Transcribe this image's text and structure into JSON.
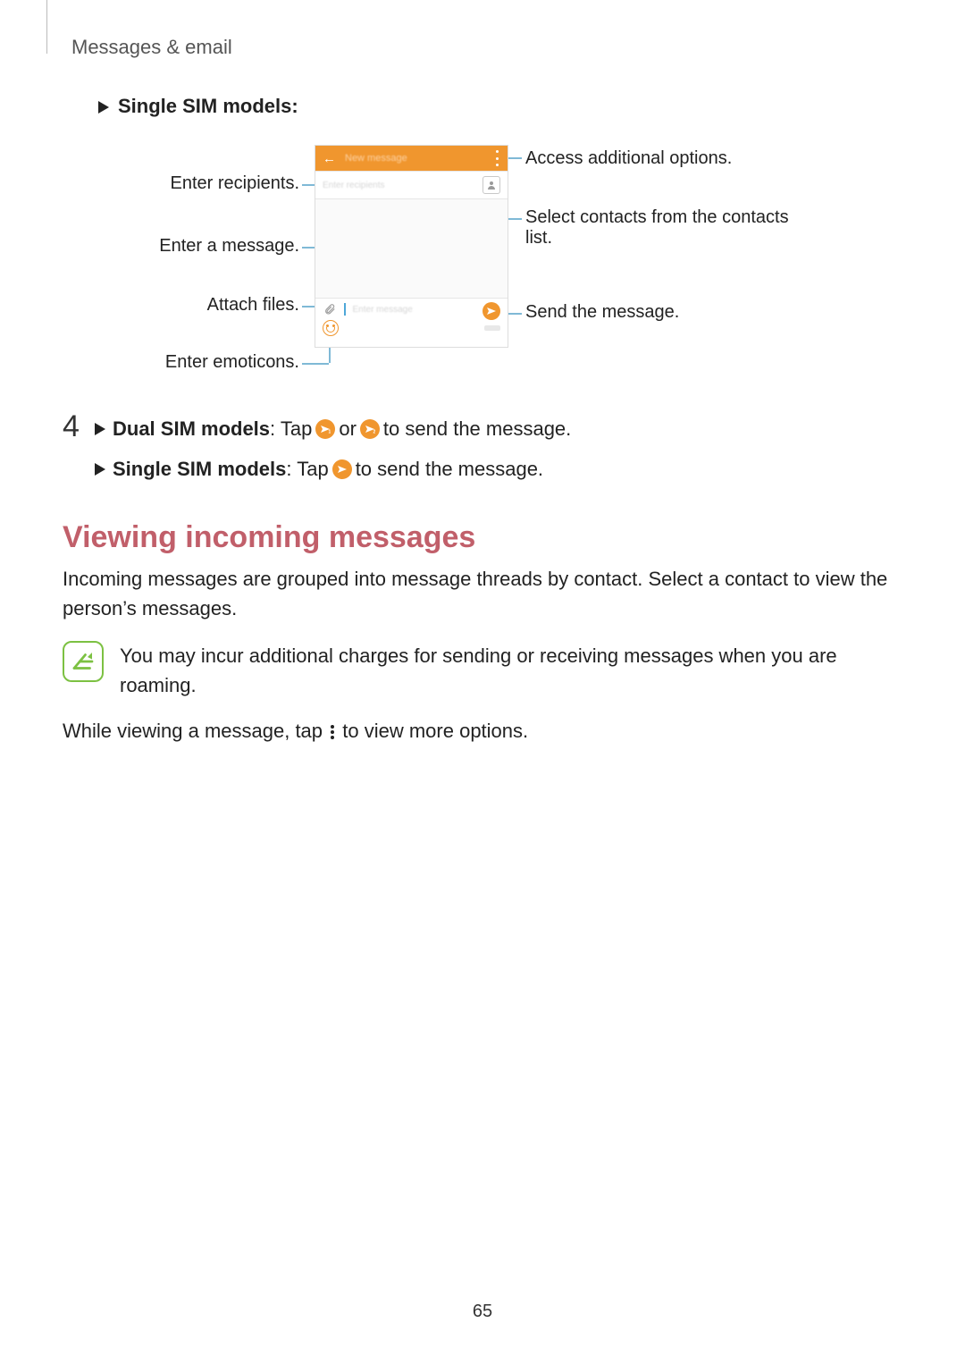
{
  "breadcrumb": "Messages & email",
  "single_sim_label": "Single SIM models",
  "colon": ":",
  "callouts": {
    "enter_recipients": "Enter recipients.",
    "enter_message": "Enter a message.",
    "attach_files": "Attach files.",
    "enter_emoticons": "Enter emoticons.",
    "access_options": "Access additional options.",
    "select_contacts": "Select contacts from the contacts list.",
    "send_message": "Send the message."
  },
  "phone": {
    "title": "New message",
    "recipient_placeholder": "Enter recipients",
    "message_placeholder": "Enter message"
  },
  "step4": {
    "number": "4",
    "dual_label": "Dual SIM models",
    "dual_tail_1": ": Tap ",
    "or": " or ",
    "dual_tail_2": " to send the message.",
    "single_label": "Single SIM models",
    "single_tail_1": ": Tap ",
    "single_tail_2": " to send the message."
  },
  "section_heading": "Viewing incoming messages",
  "incoming_text": "Incoming messages are grouped into message threads by contact. Select a contact to view the person’s messages.",
  "note_text": "You may incur additional charges for sending or receiving messages when you are roaming.",
  "final_pre": "While viewing a message, tap ",
  "final_post": " to view more options.",
  "page_number": "65"
}
